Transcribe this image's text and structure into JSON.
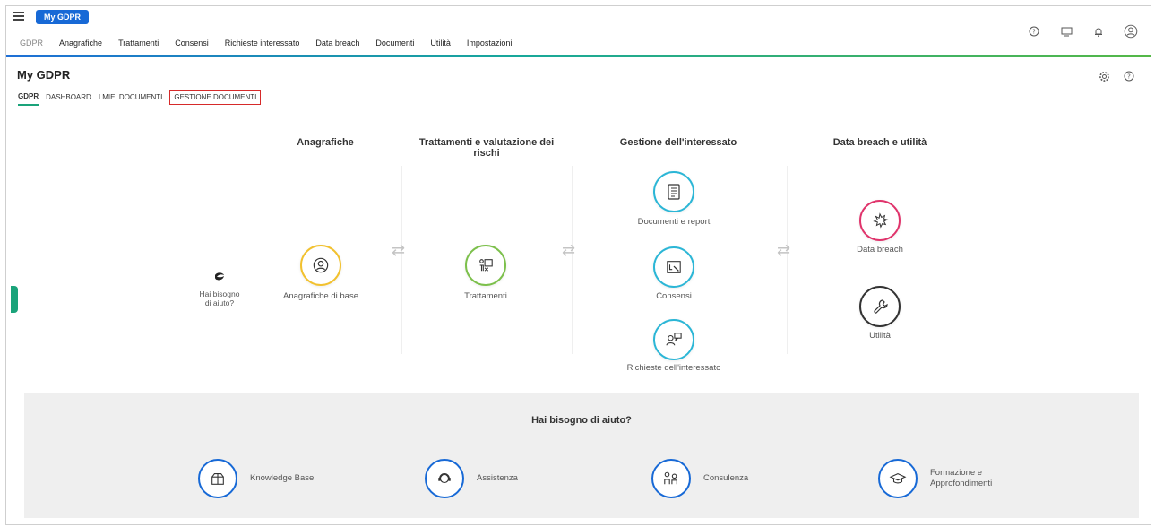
{
  "app": {
    "pill": "My GDPR"
  },
  "menu": [
    "GDPR",
    "Anagrafiche",
    "Trattamenti",
    "Consensi",
    "Richieste interessato",
    "Data breach",
    "Documenti",
    "Utilità",
    "Impostazioni"
  ],
  "page": {
    "title": "My GDPR"
  },
  "subtabs": [
    "GDPR",
    "DASHBOARD",
    "I MIEI DOCUMENTI",
    "GESTIONE DOCUMENTI"
  ],
  "columns": {
    "anagrafiche": "Anagrafiche",
    "trattamenti_line1": "Trattamenti e valutazione dei",
    "trattamenti_line2": "rischi",
    "interessato": "Gestione dell'interessato",
    "breach": "Data breach e utilità"
  },
  "modules": {
    "anagrafiche_base": "Anagrafiche di base",
    "trattamenti": "Trattamenti",
    "documenti_report": "Documenti e report",
    "consensi": "Consensi",
    "richieste": "Richieste dell'interessato",
    "data_breach": "Data breach",
    "utilita": "Utilità"
  },
  "help_left": {
    "line1": "Hai bisogno",
    "line2": "di aiuto?"
  },
  "help_panel": {
    "title": "Hai bisogno di aiuto?",
    "knowledge": "Knowledge Base",
    "assistenza": "Assistenza",
    "consulenza": "Consulenza",
    "formazione_line1": "Formazione e",
    "formazione_line2": "Approfondimenti"
  },
  "colors": {
    "accent_blue": "#1769d6",
    "accent_green": "#1aa37a",
    "anagrafiche_ring": "#f2c12e",
    "trattamenti_ring": "#7cc04b",
    "interessato_ring": "#2bb6d6",
    "breach_ring": "#e0336b",
    "utilita_ring": "#333333",
    "highlight_box": "#d62a2a"
  },
  "icons": {
    "menu": "hamburger-icon",
    "help": "question-circle-icon",
    "monitor": "monitor-icon",
    "bell": "bell-icon",
    "user": "user-circle-icon",
    "settings": "gear-icon"
  }
}
